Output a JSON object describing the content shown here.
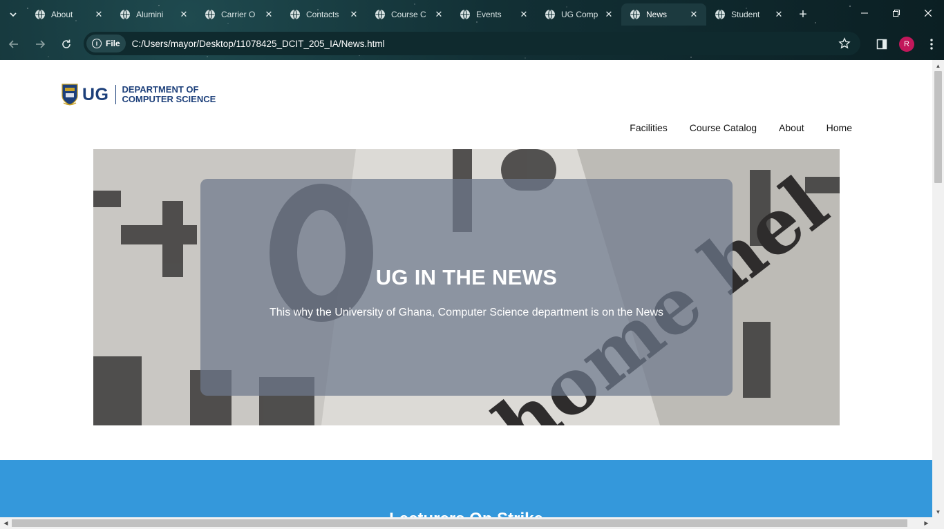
{
  "browser": {
    "tabs": [
      {
        "title": "About",
        "active": false
      },
      {
        "title": "Alumini",
        "active": false
      },
      {
        "title": "Carrier O",
        "active": false
      },
      {
        "title": "Contacts",
        "active": false
      },
      {
        "title": "Course C",
        "active": false
      },
      {
        "title": "Events",
        "active": false
      },
      {
        "title": "UG Comp",
        "active": false
      },
      {
        "title": "News",
        "active": true
      },
      {
        "title": "Student",
        "active": false
      }
    ],
    "chip_label": "File",
    "url": "C:/Users/mayor/Desktop/11078425_DCIT_205_IA/News.html",
    "profile_initial": "R",
    "accent_color": "#c2185b"
  },
  "page": {
    "logo": {
      "short": "UG",
      "line1": "DEPARTMENT OF",
      "line2": "COMPUTER SCIENCE"
    },
    "nav": [
      "Facilities",
      "Course Catalog",
      "About",
      "Home"
    ],
    "hero": {
      "title": "UG IN THE NEWS",
      "subtitle": "This why the University of Ghana, Computer Science department is on the News"
    },
    "section": {
      "heading": "Lecturers On Strike",
      "background": "#3498db"
    }
  }
}
